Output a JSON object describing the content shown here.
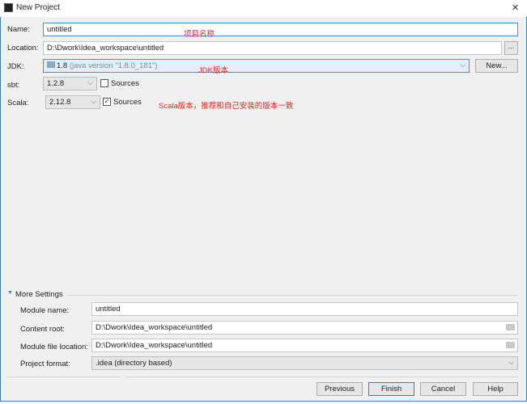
{
  "window": {
    "title": "New Project",
    "close": "✕"
  },
  "form": {
    "name_label": "Name:",
    "name_value": "untitled",
    "location_label": "Location:",
    "location_value": "D:\\Dwork\\Idea_workspace\\untitled",
    "browse_label": "...",
    "jdk_label": "JDK:",
    "jdk_value": "1.8",
    "jdk_detail": "(java version \"1.8.0_181\")",
    "new_label": "New...",
    "sbt_label": "sbt:",
    "sbt_value": "1.2.8",
    "sbt_sources_label": "Sources",
    "sbt_sources_checked": false,
    "scala_label": "Scala:",
    "scala_value": "2.12.8",
    "scala_sources_label": "Sources",
    "scala_sources_checked": true
  },
  "annotations": {
    "name": "项目名称",
    "jdk": "JDK版本",
    "scala": "Scala版本，推荐和自己安装的版本一致"
  },
  "more_settings": {
    "title": "More Settings",
    "module_name_label": "Module name:",
    "module_name_value": "untitled",
    "content_root_label": "Content root:",
    "content_root_value": "D:\\Dwork\\Idea_workspace\\untitled",
    "module_file_label": "Module file location:",
    "module_file_value": "D:\\Dwork\\Idea_workspace\\untitled",
    "format_label": "Project format:",
    "format_value": ".idea (directory based)"
  },
  "buttons": {
    "previous": "Previous",
    "finish": "Finish",
    "cancel": "Cancel",
    "help": "Help"
  },
  "colors": {
    "annotation": "#e8251f",
    "focus": "#3c7fc2"
  }
}
